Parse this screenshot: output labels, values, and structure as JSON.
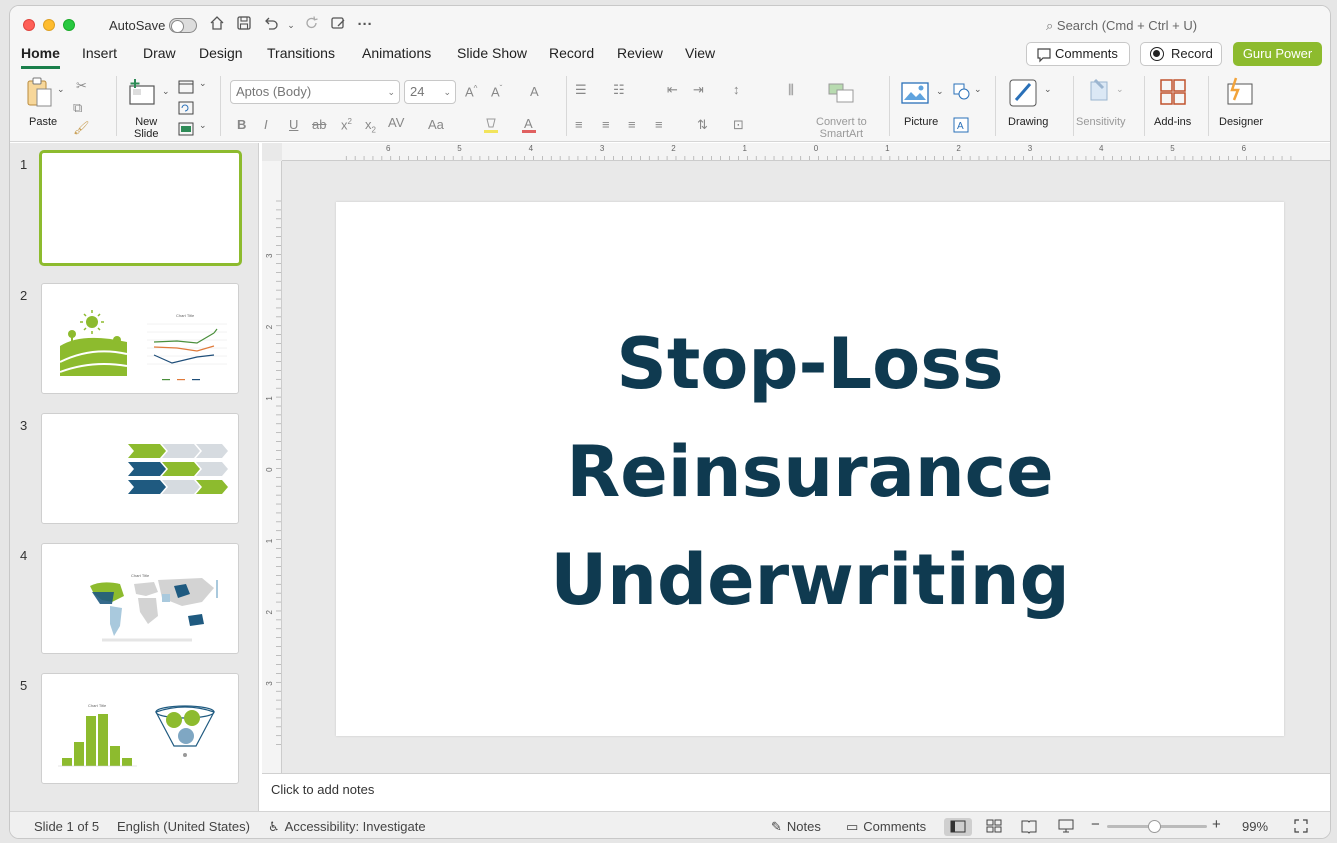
{
  "titlebar": {
    "autosave_label": "AutoSave",
    "search_placeholder": "Search (Cmd + Ctrl + U)"
  },
  "menu": {
    "tabs": [
      "Home",
      "Insert",
      "Draw",
      "Design",
      "Transitions",
      "Animations",
      "Slide Show",
      "Record",
      "Review",
      "View"
    ],
    "active": "Home",
    "comments_label": "Comments",
    "record_label": "Record",
    "guru_label": "Guru Power"
  },
  "ribbon": {
    "paste_label": "Paste",
    "new_slide_label_1": "New",
    "new_slide_label_2": "Slide",
    "font_name": "Aptos (Body)",
    "font_size": "24",
    "convert_label_1": "Convert to",
    "convert_label_2": "SmartArt",
    "picture_label": "Picture",
    "drawing_label": "Drawing",
    "sensitivity_label": "Sensitivity",
    "addins_label": "Add-ins",
    "designer_label": "Designer"
  },
  "slides": {
    "numbers": [
      "1",
      "2",
      "3",
      "4",
      "5"
    ],
    "selected": 1,
    "thumb2_chart_title": "Chart Title",
    "thumb4_chart_title": "Chart Title",
    "thumb5_chart_title": "Chart Title"
  },
  "slide": {
    "title_line1": "Stop-Loss",
    "title_line2": "Reinsurance",
    "title_line3": "Underwriting"
  },
  "notes": {
    "placeholder": "Click to add notes"
  },
  "ruler": {
    "h_labels": [
      "6",
      "5",
      "4",
      "3",
      "2",
      "1",
      "0",
      "1",
      "2",
      "3",
      "4",
      "5",
      "6"
    ],
    "v_labels": [
      "3",
      "2",
      "1",
      "0",
      "1",
      "2",
      "3"
    ]
  },
  "status": {
    "slide_counter": "Slide 1 of 5",
    "language": "English (United States)",
    "accessibility": "Accessibility: Investigate",
    "notes_label": "Notes",
    "comments_label": "Comments",
    "zoom_level": "99%"
  },
  "colors": {
    "accent_green": "#8dbb2e",
    "title_navy": "#0f3a50",
    "tab_underline": "#1a7f4b"
  }
}
